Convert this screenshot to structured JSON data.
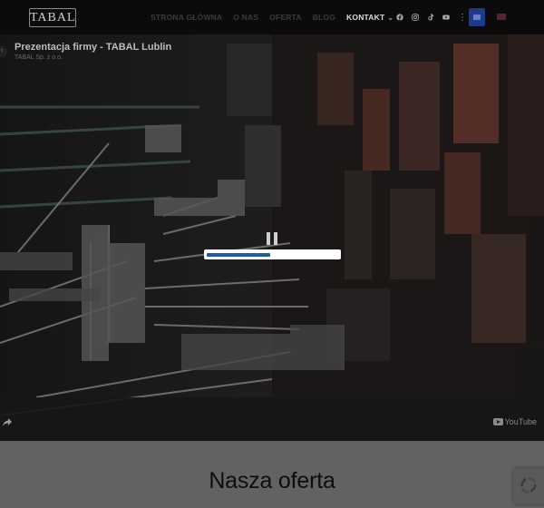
{
  "brand": {
    "logo_text": "TABAL"
  },
  "nav": {
    "items": [
      {
        "label": "STRONA GŁÓWNA",
        "active": false
      },
      {
        "label": "O NAS",
        "active": false
      },
      {
        "label": "OFERTA",
        "active": false
      },
      {
        "label": "BLOG",
        "active": false
      },
      {
        "label": "KONTAKT",
        "active": true
      }
    ],
    "social_icons": [
      "facebook-icon",
      "instagram-icon",
      "tiktok-icon",
      "youtube-icon"
    ],
    "languages": [
      "pl",
      "en"
    ]
  },
  "video": {
    "title": "Prezentacja firmy - TABAL Lublin",
    "subtitle": "TABAL Sp. z o.o.",
    "provider": "YouTube",
    "progress_percent": 48
  },
  "offer": {
    "heading": "Nasza oferta"
  },
  "colors": {
    "accent": "#1d5aa8",
    "nav_bg": "#0b0b0b",
    "offer_bg": "#626262"
  }
}
